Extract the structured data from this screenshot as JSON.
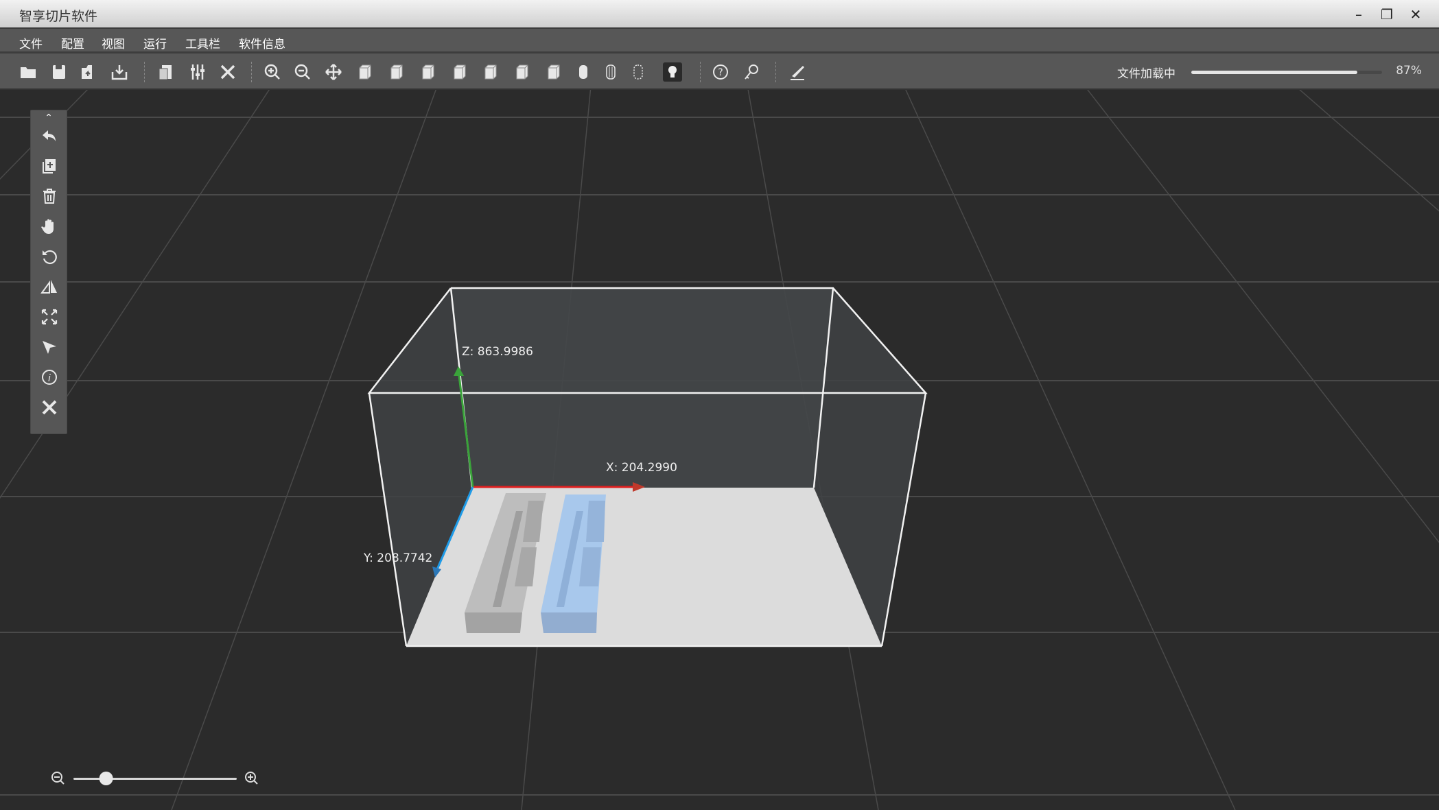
{
  "window": {
    "title": "智享切片软件",
    "minimize": "–",
    "restore": "❐",
    "close": "✕"
  },
  "menu": [
    "文件",
    "配置",
    "视图",
    "运行",
    "工具栏",
    "软件信息"
  ],
  "toolbar": {
    "icons": [
      "open-folder",
      "save",
      "save-as",
      "import",
      "slice-settings",
      "adjust-sliders",
      "tools",
      "zoom-in",
      "zoom-out",
      "move",
      "view-front-cube",
      "view-back-cube",
      "view-left-cube",
      "view-right-cube",
      "view-top-cube",
      "view-bottom-cube",
      "view-iso-cube",
      "cylinder-solid",
      "cylinder-wire",
      "cylinder-dotted",
      "light-bulb",
      "help",
      "key",
      "scalpel"
    ],
    "active": "light-bulb"
  },
  "loading": {
    "label": "文件加载中",
    "progress": 87,
    "percent_text": "87%"
  },
  "sidebar": {
    "collapse": "⌃",
    "icons": [
      "undo",
      "copy-add",
      "delete",
      "hand-pan",
      "rotate",
      "mirror-scale",
      "fit-expand",
      "select-pointer",
      "info",
      "repair-tools"
    ]
  },
  "axes": {
    "z_label": "Z:  863.9986",
    "x_label": "X: 204.2990",
    "y_label": "Y:  208.7742",
    "colors": {
      "x": "#e02020",
      "y": "#1e9be8",
      "z": "#3aa33a"
    }
  },
  "models": [
    {
      "color": "#bdbdbd"
    },
    {
      "color": "#a8c8ec",
      "selected": true
    }
  ],
  "zoom_slider": {
    "level": 0.2
  }
}
